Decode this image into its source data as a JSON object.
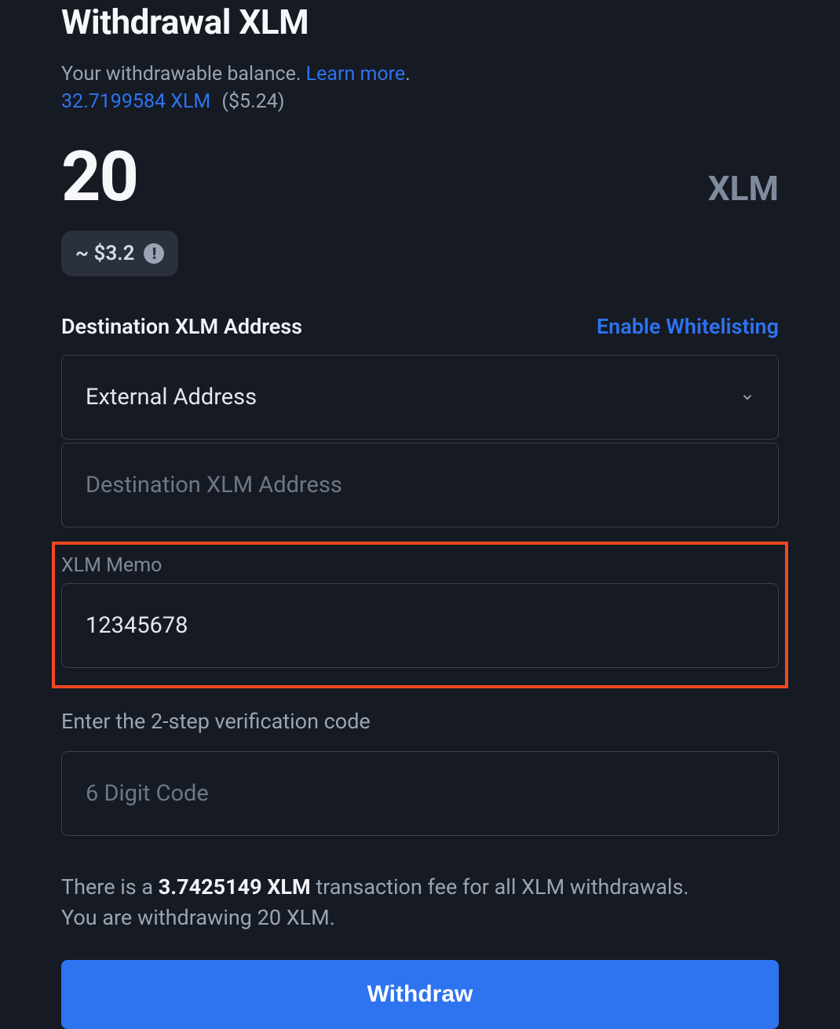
{
  "header": {
    "title": "Withdrawal XLM",
    "subtitle_prefix": "Your withdrawable balance. ",
    "learn_more": "Learn more",
    "subtitle_suffix": "."
  },
  "balance": {
    "amount_link": "32.7199584 XLM",
    "usd_display": "($5.24)"
  },
  "amount": {
    "value": "20",
    "currency": "XLM",
    "approx_usd": "~ $3.2"
  },
  "destination": {
    "label": "Destination XLM Address",
    "enable_whitelisting": "Enable Whitelisting",
    "dropdown_selected": "External Address",
    "address_placeholder": "Destination XLM Address"
  },
  "memo": {
    "label": "XLM Memo",
    "value": "12345678"
  },
  "verification": {
    "label": "Enter the 2-step verification code",
    "placeholder": "6 Digit Code"
  },
  "fee": {
    "prefix": "There is a ",
    "amount": "3.7425149 XLM",
    "suffix1": " transaction fee for all XLM withdrawals. ",
    "suffix2": "You are withdrawing 20 XLM."
  },
  "actions": {
    "withdraw": "Withdraw"
  }
}
